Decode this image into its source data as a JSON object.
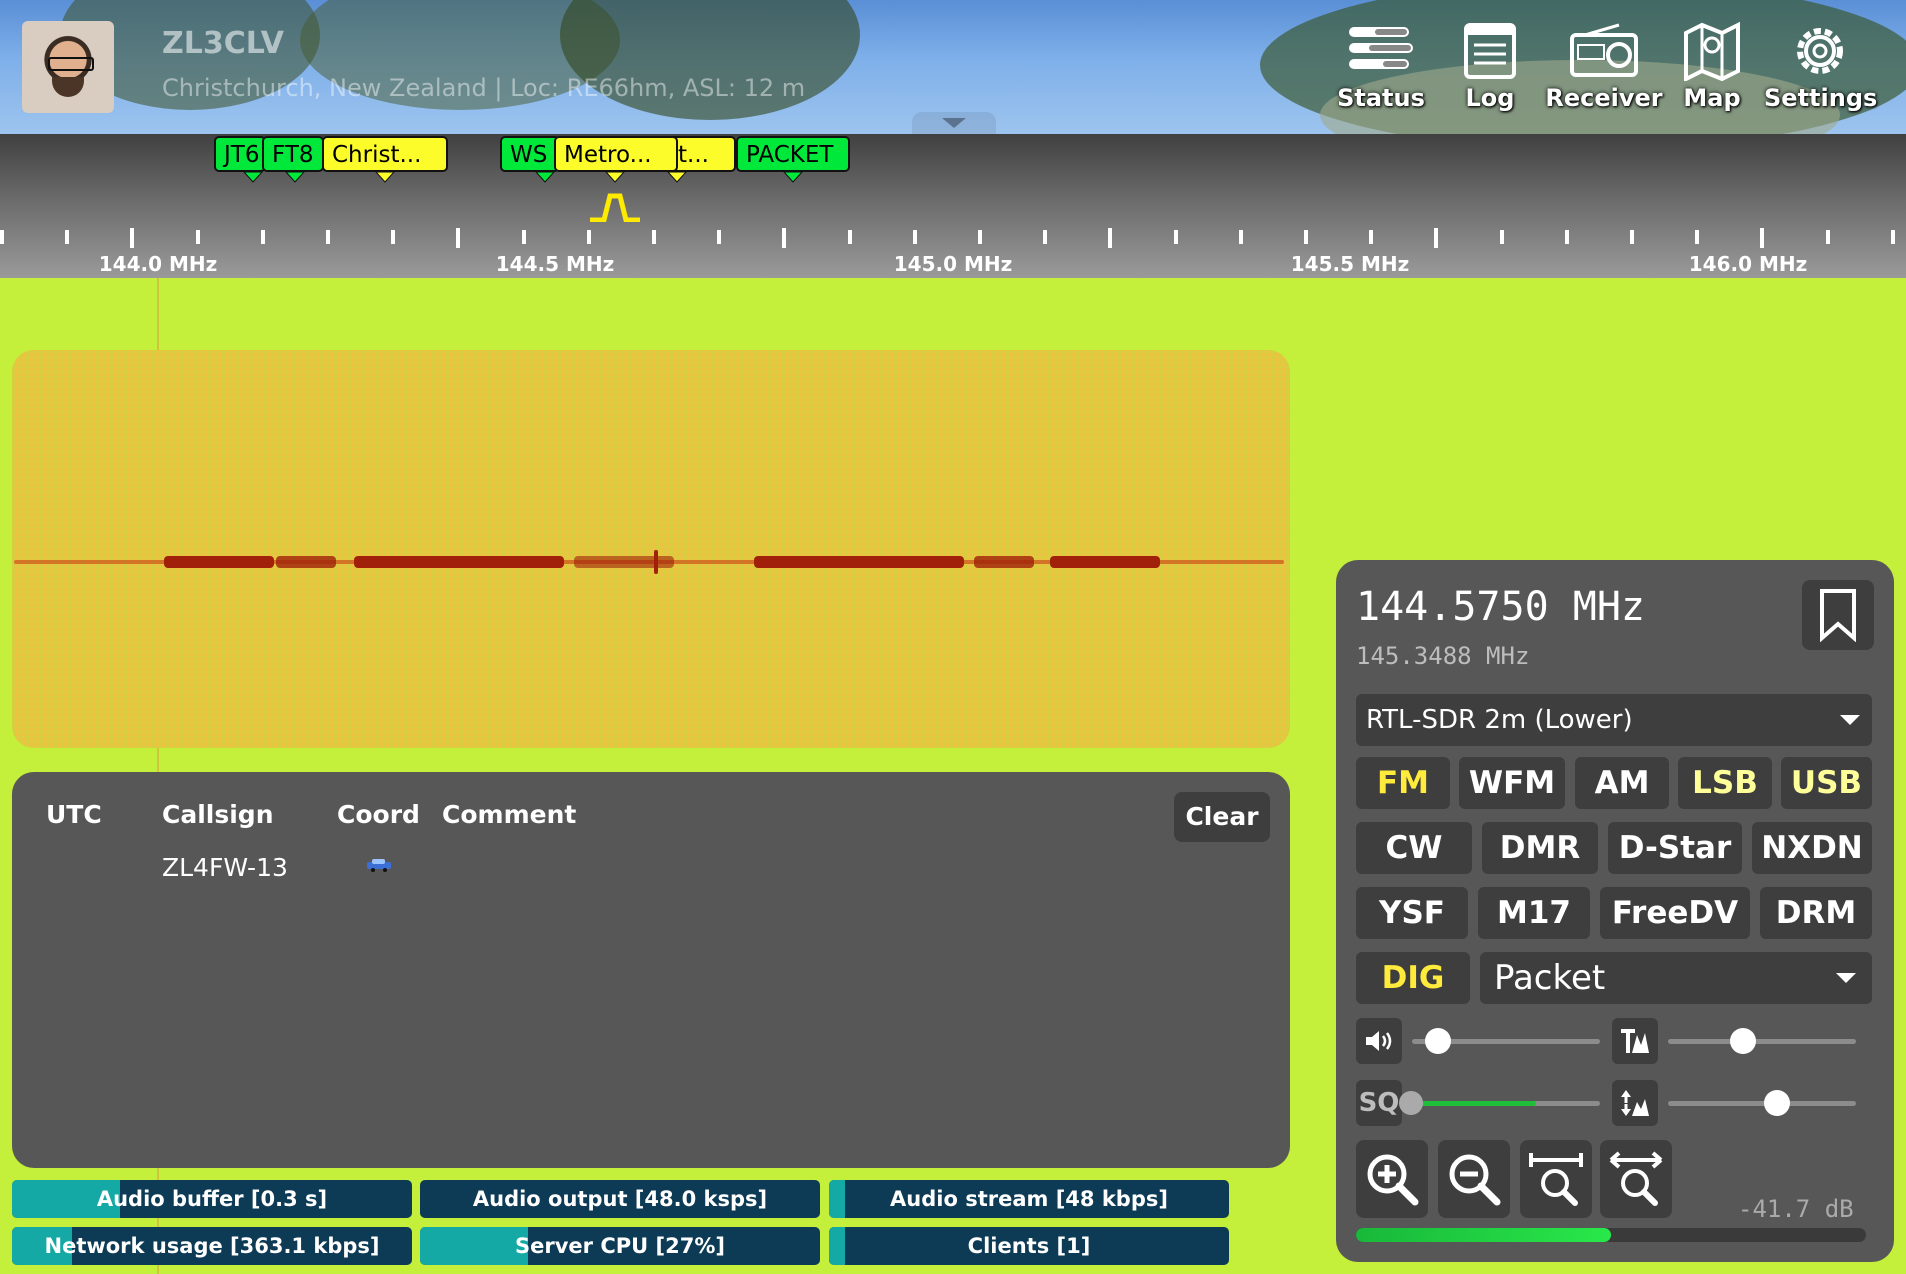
{
  "header": {
    "callsign_title": "ZL3CLV",
    "description": "Christchurch, New Zealand | Loc: RE66hm, ASL: 12 m",
    "nav": [
      {
        "label": "Status",
        "icon": "status-icon"
      },
      {
        "label": "Log",
        "icon": "log-icon"
      },
      {
        "label": "Receiver",
        "icon": "receiver-icon"
      },
      {
        "label": "Map",
        "icon": "map-icon"
      },
      {
        "label": "Settings",
        "icon": "gear-icon"
      }
    ]
  },
  "bookmarks": [
    {
      "label": "JT6",
      "color": "green"
    },
    {
      "label": "FT8",
      "color": "green"
    },
    {
      "label": "Christ...",
      "color": "yellow"
    },
    {
      "label": "WS",
      "color": "green"
    },
    {
      "label": "Metro...",
      "color": "yellow"
    },
    {
      "label": "t...",
      "color": "yellow"
    },
    {
      "label": "PACKET",
      "color": "green"
    }
  ],
  "scale": {
    "labels": [
      "144.0 MHz",
      "144.5 MHz",
      "145.0 MHz",
      "145.5 MHz",
      "146.0 MHz"
    ]
  },
  "packet": {
    "headers": {
      "utc": "UTC",
      "callsign": "Callsign",
      "coord": "Coord",
      "comment": "Comment"
    },
    "clear_label": "Clear",
    "rows": [
      {
        "utc": "",
        "callsign": "ZL4FW-13",
        "coord_icon": "car-icon",
        "comment": ""
      }
    ]
  },
  "status_bars": [
    {
      "label": "Audio buffer [0.3 s]",
      "level": 0.27
    },
    {
      "label": "Audio output [48.0 ksps]",
      "level": 0.0
    },
    {
      "label": "Audio stream [48 kbps]",
      "level": 0.04
    },
    {
      "label": "Network usage [363.1 kbps]",
      "level": 0.15
    },
    {
      "label": "Server CPU [27%]",
      "level": 0.27
    },
    {
      "label": "Clients [1]",
      "level": 0.04
    }
  ],
  "receiver": {
    "frequency": "144.5750 MHz",
    "center_frequency": "145.3488 MHz",
    "profile": "RTL-SDR 2m (Lower)",
    "modes_row1": [
      "FM",
      "WFM",
      "AM",
      "LSB",
      "USB"
    ],
    "modes_row2": [
      "CW",
      "DMR",
      "D-Star",
      "NXDN"
    ],
    "modes_row3": [
      "YSF",
      "M17",
      "FreeDV",
      "DRM"
    ],
    "dig_label": "DIG",
    "digital_mode": "Packet",
    "squelch_label": "SQ",
    "volume_level": 0.14,
    "nr_level": 0.4,
    "squelch_level": 0.0,
    "squelch_signal": 0.66,
    "gain_level": 0.58,
    "smeter_label": "-41.7 dB",
    "smeter_level": 0.5
  },
  "colors": {
    "waterfall_bg": "#c4ef3a",
    "bookmark_green": "#00e83a",
    "bookmark_yellow": "#fcfc2a",
    "active_mode": "#ffeb3b",
    "status_fill": "#15a9a6",
    "status_bg": "#0d3b55"
  }
}
